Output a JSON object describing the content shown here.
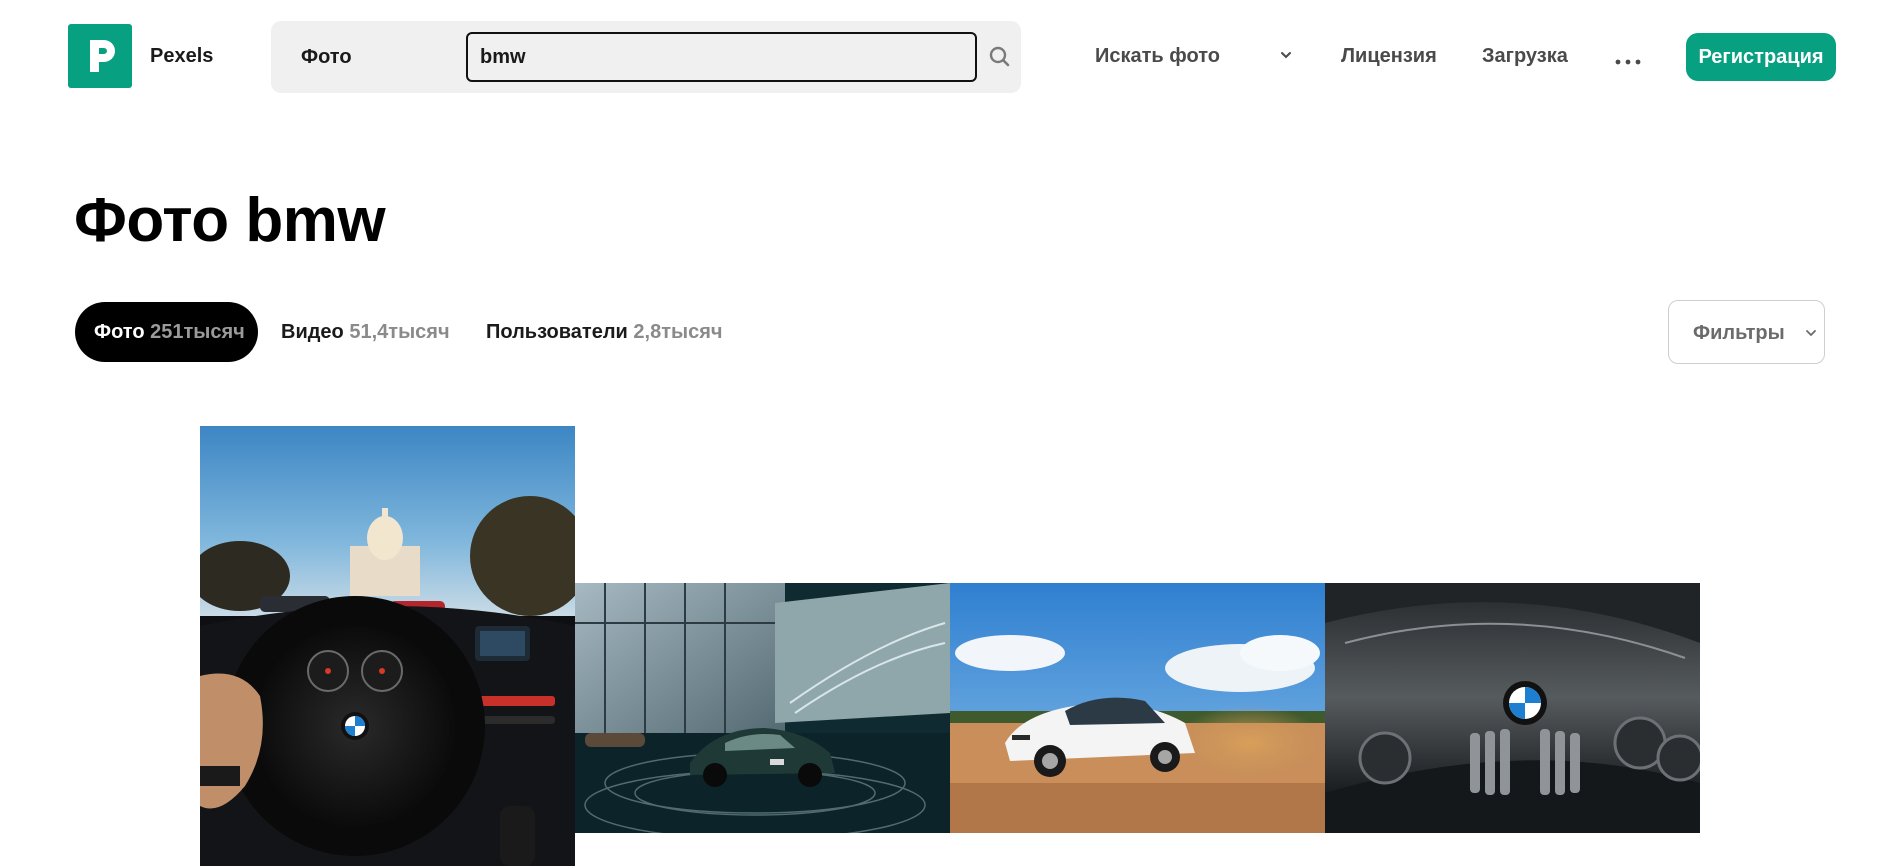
{
  "brand": {
    "name": "Pexels",
    "accent_color": "#07a081"
  },
  "search": {
    "type_label": "Фото",
    "value": "bmw",
    "icon": "search-icon"
  },
  "nav": {
    "explore_label": "Искать фото",
    "license_label": "Лицензия",
    "upload_label": "Загрузка",
    "more_icon": "more-horizontal-icon",
    "signup_label": "Регистрация"
  },
  "page": {
    "title": "Фото bmw"
  },
  "tabs": [
    {
      "label": "Фото",
      "count": "251тысяч",
      "active": true
    },
    {
      "label": "Видео",
      "count": "51,4тысяч",
      "active": false
    },
    {
      "label": "Пользователи",
      "count": "2,8тысяч",
      "active": false
    }
  ],
  "filters": {
    "label": "Фильтры"
  },
  "photos": [
    {
      "subject": "bmw-steering-wheel-interior"
    },
    {
      "subject": "bmw-showroom-green-coupe"
    },
    {
      "subject": "white-bmw-drifting-dirt"
    },
    {
      "subject": "bmw-hood-emblem-grille"
    }
  ]
}
